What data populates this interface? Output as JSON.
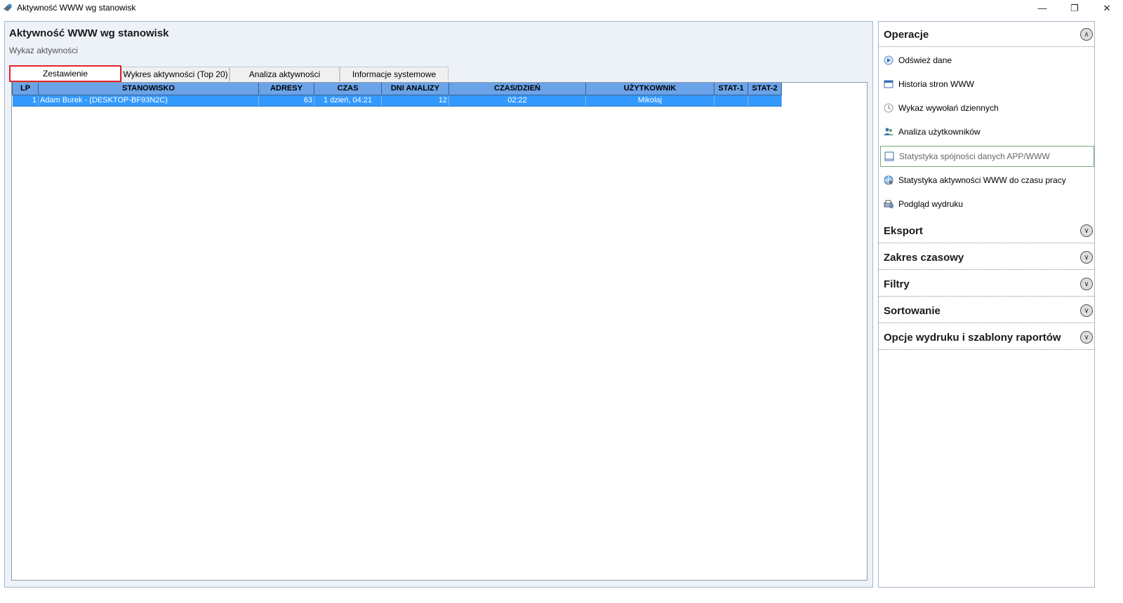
{
  "window": {
    "title": "Aktywność WWW wg stanowisk",
    "controls": {
      "minimize": "—",
      "maximize": "❐",
      "close": "✕"
    }
  },
  "main": {
    "title": "Aktywność WWW wg stanowisk",
    "subtitle": "Wykaz aktywności",
    "tabs": [
      {
        "label": "Zestawienie",
        "active": true
      },
      {
        "label": "Wykres aktywności (Top 20)",
        "active": false
      },
      {
        "label": "Analiza aktywności",
        "active": false
      },
      {
        "label": "Informacje systemowe",
        "active": false
      }
    ],
    "table": {
      "columns": [
        "LP",
        "STANOWISKO",
        "ADRESY",
        "CZAS",
        "DNI ANALIZY",
        "CZAS/DZIEŃ",
        "UŻYTKOWNIK",
        "STAT-1",
        "STAT-2"
      ],
      "rows": [
        {
          "lp": "1",
          "stanowisko": "Adam Burek - (DESKTOP-BF93N2C)",
          "adresy": "63",
          "czas": "1 dzień, 04:21",
          "dni": "12",
          "czas_dzien": "02:22",
          "uzytkownik": "Mikolaj",
          "stat1": "",
          "stat2": ""
        }
      ]
    }
  },
  "side": {
    "operacje": {
      "title": "Operacje",
      "items": [
        {
          "label": "Odśwież dane",
          "icon": "refresh-play-icon"
        },
        {
          "label": "Historia stron WWW",
          "icon": "browser-window-icon"
        },
        {
          "label": "Wykaz wywołań dziennych",
          "icon": "clock-icon"
        },
        {
          "label": "Analiza użytkowników",
          "icon": "users-icon"
        },
        {
          "label": "Statystyka spójności danych APP/WWW",
          "icon": "window-stats-icon"
        },
        {
          "label": "Statystyka aktywności WWW do czasu pracy",
          "icon": "globe-gear-icon"
        },
        {
          "label": "Podgląd wydruku",
          "icon": "print-preview-icon"
        }
      ]
    },
    "sections": [
      {
        "title": "Eksport"
      },
      {
        "title": "Zakres czasowy"
      },
      {
        "title": "Filtry"
      },
      {
        "title": "Sortowanie"
      },
      {
        "title": "Opcje wydruku i szablony raportów"
      }
    ],
    "toggle_up": "∧",
    "toggle_down": "∨"
  }
}
